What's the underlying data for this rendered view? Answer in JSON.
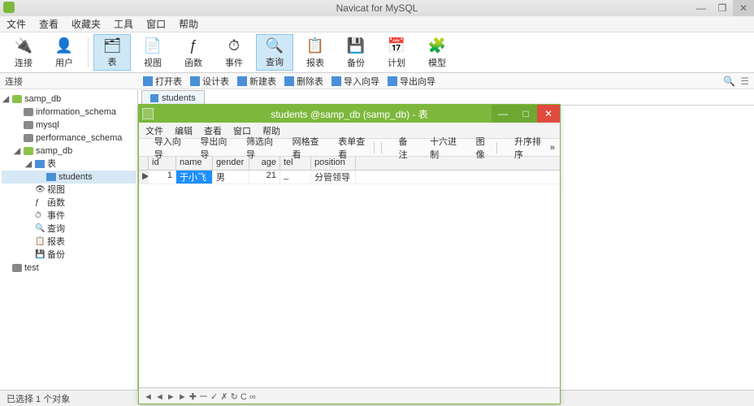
{
  "app": {
    "title": "Navicat for MySQL"
  },
  "menubar": [
    "文件",
    "查看",
    "收藏夹",
    "工具",
    "窗口",
    "帮助"
  ],
  "ribbon": [
    {
      "label": "连接",
      "icon": "🔌",
      "active": false
    },
    {
      "label": "用户",
      "icon": "👤",
      "active": false
    },
    {
      "sep": true
    },
    {
      "label": "表",
      "icon": "🗂",
      "active": true
    },
    {
      "label": "视图",
      "icon": "📄",
      "active": false
    },
    {
      "label": "函数",
      "icon": "ƒ",
      "active": false
    },
    {
      "label": "事件",
      "icon": "⏱",
      "active": false
    },
    {
      "label": "查询",
      "icon": "🔍",
      "active": true
    },
    {
      "label": "报表",
      "icon": "📋",
      "active": false
    },
    {
      "label": "备份",
      "icon": "💾",
      "active": false
    },
    {
      "label": "计划",
      "icon": "📅",
      "active": false
    },
    {
      "label": "模型",
      "icon": "🧩",
      "active": false
    }
  ],
  "subhdr": {
    "conn_label": "连接",
    "tools": [
      "打开表",
      "设计表",
      "新建表",
      "删除表",
      "导入向导",
      "导出向导"
    ]
  },
  "tree": {
    "root": "samp_db",
    "schemas": [
      "information_schema",
      "mysql",
      "performance_schema"
    ],
    "open_db": "samp_db",
    "table_group": "表",
    "tables": [
      "students"
    ],
    "groups": [
      {
        "icon": "👁",
        "label": "视图"
      },
      {
        "icon": "ƒ",
        "label": "函数"
      },
      {
        "icon": "⏱",
        "label": "事件"
      },
      {
        "icon": "🔍",
        "label": "查询"
      },
      {
        "icon": "📋",
        "label": "报表"
      },
      {
        "icon": "💾",
        "label": "备份"
      }
    ],
    "other_conn": "test"
  },
  "tabs": {
    "open": "students"
  },
  "child": {
    "title": "students @samp_db (samp_db) - 表",
    "menu": [
      "文件",
      "编辑",
      "查看",
      "窗口",
      "帮助"
    ],
    "tool": [
      "导入向导",
      "导出向导",
      "筛选向导",
      "网格查看",
      "表单查看",
      "备注",
      "十六进制",
      "图像",
      "升序排序"
    ],
    "columns": [
      "id",
      "name",
      "gender",
      "age",
      "tel",
      "position"
    ],
    "row": {
      "id": "1",
      "name": "于小飞",
      "gender": "男",
      "age": "21",
      "tel": "_",
      "position": "分管领导"
    },
    "record_nav": "◄ ◄ ► ► ✚ ー ✓ ✗ ↻  C ∞"
  },
  "status": {
    "text": "已选择 1 个对象"
  }
}
